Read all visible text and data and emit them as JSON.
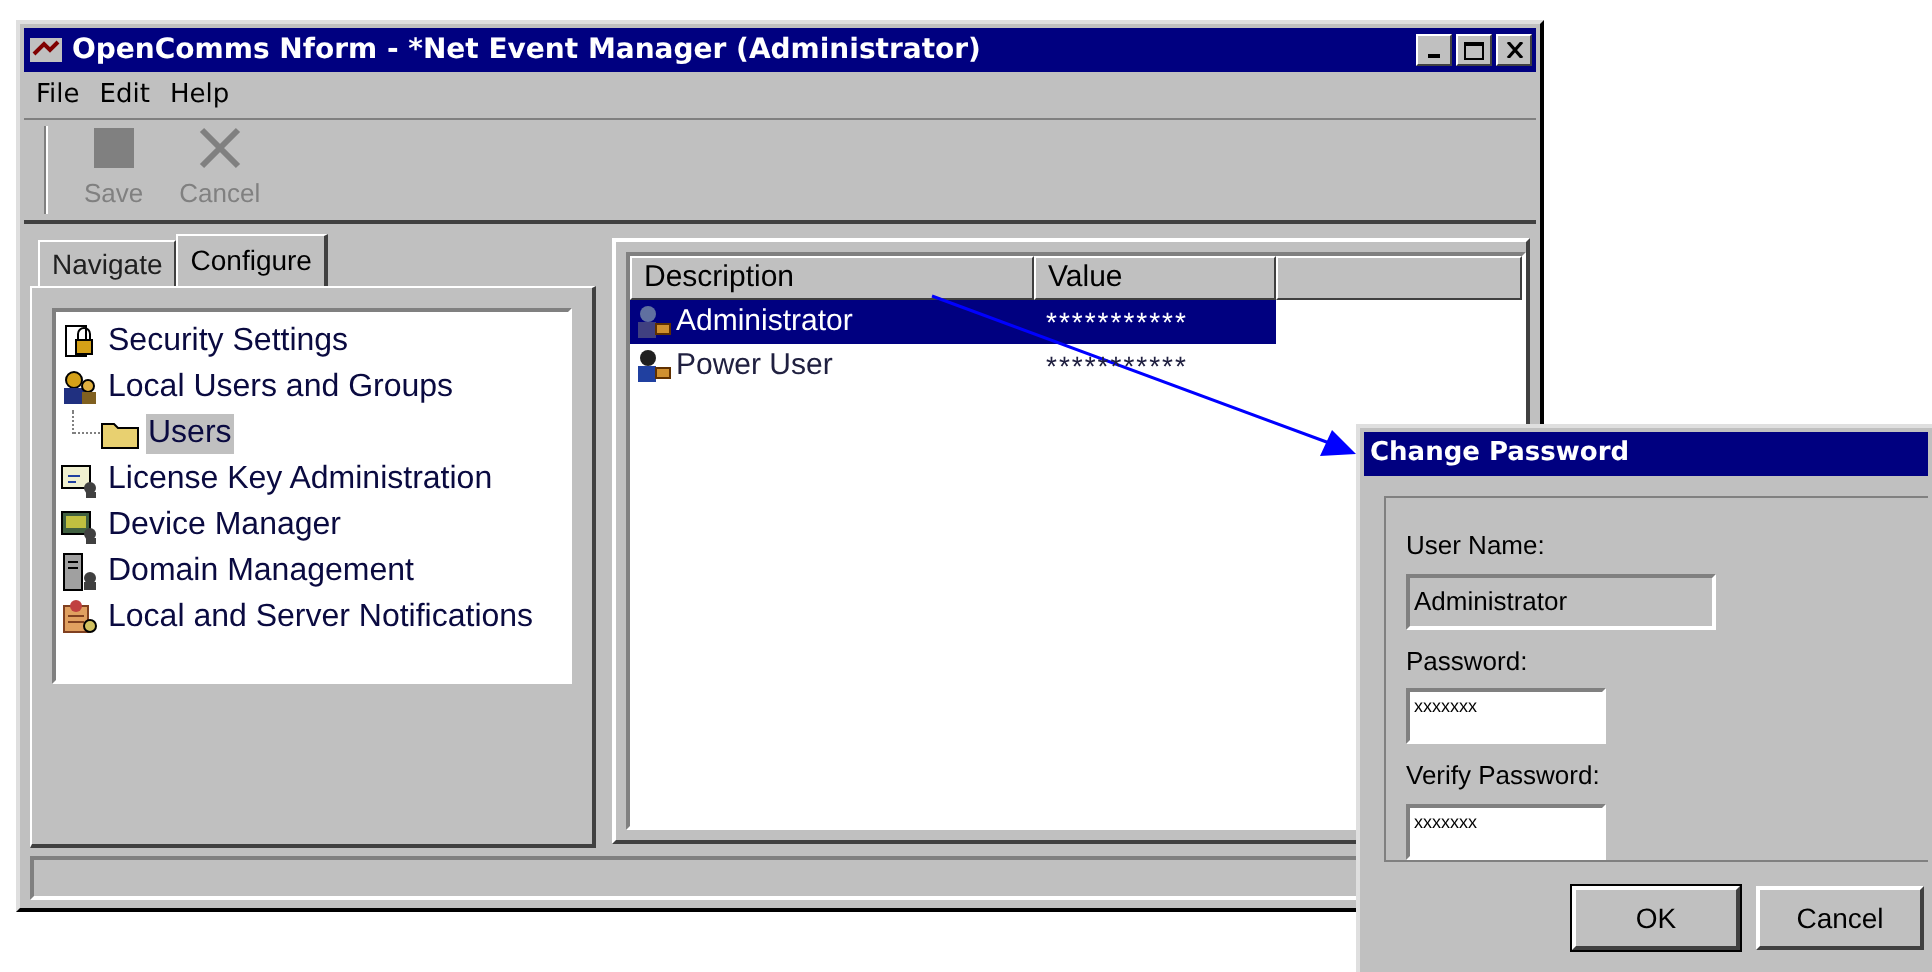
{
  "window": {
    "title": "OpenComms Nform - *Net Event Manager (Administrator)"
  },
  "menu": [
    "File",
    "Edit",
    "Help"
  ],
  "toolbar": [
    {
      "label": "Save",
      "disabled": true
    },
    {
      "label": "Cancel",
      "disabled": true
    }
  ],
  "tabs": [
    {
      "label": "Navigate",
      "selected": false
    },
    {
      "label": "Configure",
      "selected": true
    }
  ],
  "tree": [
    {
      "label": "Security Settings",
      "selected": false
    },
    {
      "label": "Local Users and Groups",
      "selected": false,
      "expanded": true,
      "children": [
        {
          "label": "Users",
          "selected": true
        }
      ]
    },
    {
      "label": "License Key Administration",
      "selected": false
    },
    {
      "label": "Device Manager",
      "selected": false
    },
    {
      "label": "Domain Management",
      "selected": false
    },
    {
      "label": "Local and Server Notifications",
      "selected": false
    }
  ],
  "list": {
    "columns": [
      "Description",
      "Value"
    ],
    "rows": [
      {
        "description": "Administrator",
        "value": "***********",
        "selected": true
      },
      {
        "description": "Power User",
        "value": "***********",
        "selected": false
      }
    ]
  },
  "dialog": {
    "title": "Change Password",
    "fields": [
      {
        "label": "User Name:",
        "value": "Administrator",
        "disabled": true
      },
      {
        "label": "Password:",
        "value": "xxxxxxx",
        "disabled": false
      },
      {
        "label": "Verify Password:",
        "value": "xxxxxxx",
        "disabled": false
      }
    ],
    "buttons": [
      "OK",
      "Cancel"
    ]
  }
}
